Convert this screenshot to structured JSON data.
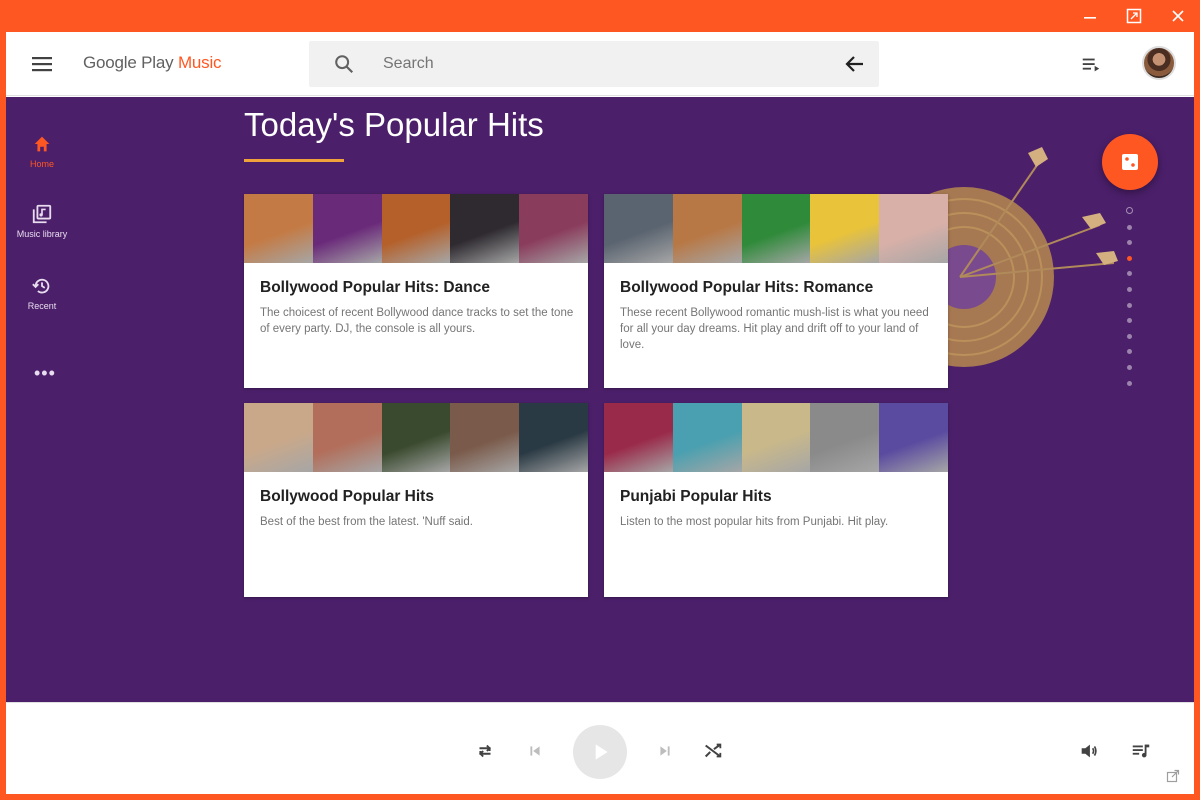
{
  "window": {
    "controls": [
      "minimize-icon",
      "restore-icon",
      "close-icon"
    ]
  },
  "header": {
    "menu_icon": "hamburger-menu-icon",
    "logo_prefix": "Google Play ",
    "logo_accent": "Music",
    "search_placeholder": "Search",
    "search_icon": "search-icon",
    "back_icon": "arrow-back-icon",
    "queue_icon": "queue-icon"
  },
  "nav": {
    "items": [
      {
        "label": "Home",
        "icon": "home-icon",
        "active": true
      },
      {
        "label": "Music library",
        "icon": "library-icon",
        "active": false
      },
      {
        "label": "Recent",
        "icon": "history-icon",
        "active": false
      }
    ],
    "more": "•••"
  },
  "page": {
    "title": "Today's Popular Hits"
  },
  "cards": [
    {
      "title": "Bollywood Popular Hits: Dance",
      "description": "The choicest of recent Bollywood dance tracks to set the tone of every party. DJ, the console is all yours.",
      "art_colors": [
        "#c47a44",
        "#6a2a7a",
        "#b5602a",
        "#2e2a30",
        "#8a3c5c"
      ]
    },
    {
      "title": "Bollywood Popular Hits: Romance",
      "description": "These recent Bollywood romantic mush-list is what you need for all your day dreams. Hit play and drift off to your land of love.",
      "art_colors": [
        "#5a6470",
        "#b87846",
        "#2f8a3a",
        "#e9c33a",
        "#d8b0a8"
      ]
    },
    {
      "title": "Bollywood Popular Hits",
      "description": "Best of the best from the latest. 'Nuff said.",
      "art_colors": [
        "#c9a88a",
        "#b26e5a",
        "#3a4a2e",
        "#7a5a4a",
        "#2a3a44"
      ]
    },
    {
      "title": "Punjabi Popular Hits",
      "description": "Listen to the most popular hits from Punjabi. Hit play.",
      "art_colors": [
        "#9a2a4a",
        "#4aa0b0",
        "#c8b88a",
        "#8a8a8a",
        "#5a4aa0"
      ]
    }
  ],
  "fab_icon": "shuffle-dice-icon",
  "pagination": {
    "total": 12,
    "active": 4
  },
  "player": {
    "controls": [
      "repeat-icon",
      "skip-previous-icon",
      "play-icon",
      "skip-next-icon",
      "shuffle-icon"
    ],
    "right": [
      "volume-icon",
      "queue-music-icon"
    ],
    "popout_icon": "open-in-new-icon"
  },
  "colors": {
    "accent": "#FF5722",
    "background": "#4b1f6a",
    "underline": "#f0a23b"
  }
}
